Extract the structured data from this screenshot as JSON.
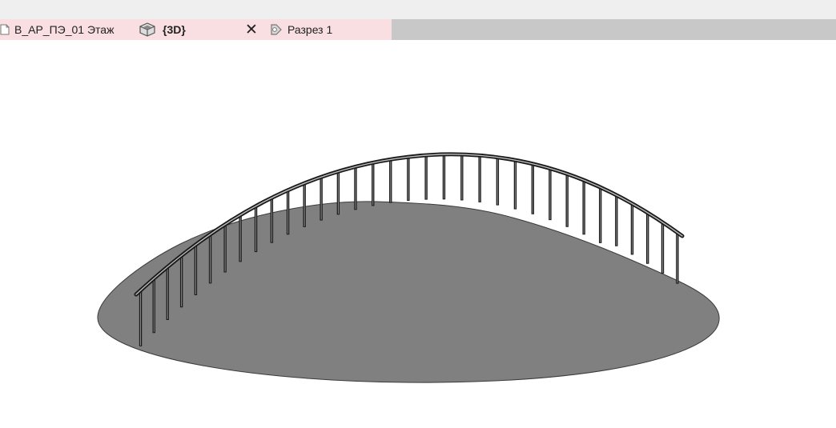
{
  "tabs": [
    {
      "label": "В_АР_ПЭ_01 Этаж",
      "icon": "floor-plan-icon"
    },
    {
      "label": "{3D}",
      "icon": "3d-view-icon",
      "active": true
    },
    {
      "label": "Разрез 1",
      "icon": "section-view-icon"
    }
  ],
  "close_icon": "close-icon",
  "colors": {
    "tab_background": "#f9dfe1",
    "tabstrip_background": "#c8c8c8",
    "slab_fill": "#808080",
    "railing_stroke": "#1a1a1a"
  }
}
